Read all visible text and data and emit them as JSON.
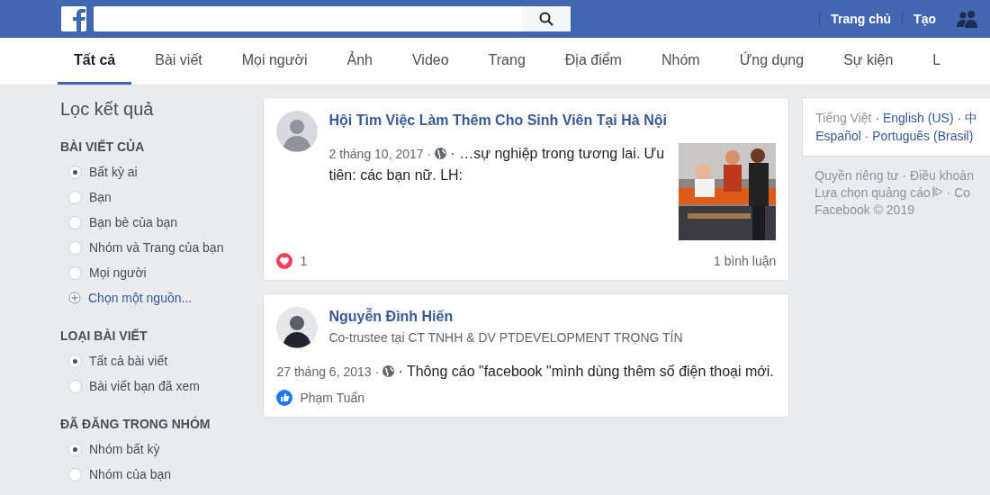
{
  "header": {
    "nav": [
      "Trang chủ",
      "Tạo"
    ]
  },
  "tabs": [
    {
      "label": "Tất cả",
      "selected": true
    },
    {
      "label": "Bài viết",
      "selected": false
    },
    {
      "label": "Mọi người",
      "selected": false
    },
    {
      "label": "Ảnh",
      "selected": false
    },
    {
      "label": "Video",
      "selected": false
    },
    {
      "label": "Trang",
      "selected": false
    },
    {
      "label": "Địa điểm",
      "selected": false
    },
    {
      "label": "Nhóm",
      "selected": false
    },
    {
      "label": "Ứng dụng",
      "selected": false
    },
    {
      "label": "Sự kiện",
      "selected": false
    },
    {
      "label": "L",
      "selected": false
    }
  ],
  "filters": {
    "title": "Lọc kết quả",
    "sections": [
      {
        "heading": "BÀI VIẾT CỦA",
        "options": [
          {
            "label": "Bất kỳ ai",
            "selected": true
          },
          {
            "label": "Bạn",
            "selected": false
          },
          {
            "label": "Bạn bè của bạn",
            "selected": false
          },
          {
            "label": "Nhóm và Trang của bạn",
            "selected": false
          },
          {
            "label": "Mọi người",
            "selected": false
          }
        ],
        "more": "Chọn một nguồn..."
      },
      {
        "heading": "LOẠI BÀI VIẾT",
        "options": [
          {
            "label": "Tất cả bài viết",
            "selected": true
          },
          {
            "label": "Bài viết bạn đã xem",
            "selected": false
          }
        ]
      },
      {
        "heading": "ĐÃ ĐĂNG TRONG NHÓM",
        "options": [
          {
            "label": "Nhóm bất kỳ",
            "selected": true
          },
          {
            "label": "Nhóm của bạn",
            "selected": false
          }
        ]
      }
    ]
  },
  "posts": [
    {
      "group": "Hội Tìm Việc Làm Thêm Cho Sinh Viên Tại Hà Nội",
      "date": "2 tháng 10, 2017 ·",
      "text": "· …sự nghiệp trong tương lai. Ưu tiên: các bạn nữ. LH:",
      "reactions": {
        "kind": "love",
        "count": "1"
      },
      "comments": "1 bình luận"
    },
    {
      "author": "Nguyễn Đình Hiến",
      "subtitle": "Co-trustee tại CT TNHH & DV PTDEVELOPMENT TRỌNG TÍN",
      "date": "27 tháng 6, 2013 ·",
      "text": "· Thông cáo \"facebook \"mình dùng thêm số điện thoại mới.",
      "reactions": {
        "kind": "like",
        "liker": "Phạm Tuấn"
      }
    }
  ],
  "right": {
    "languages": [
      [
        "Tiếng Việt",
        "· English (US)",
        "· 中"
      ],
      [
        "Español",
        "· Português (Brasil)"
      ]
    ],
    "footer_links": [
      [
        "Quyền riêng tư",
        "· Điều khoản"
      ],
      [
        "Lựa chọn quảng cáo",
        "· Co"
      ]
    ],
    "copyright": "Facebook © 2019"
  }
}
